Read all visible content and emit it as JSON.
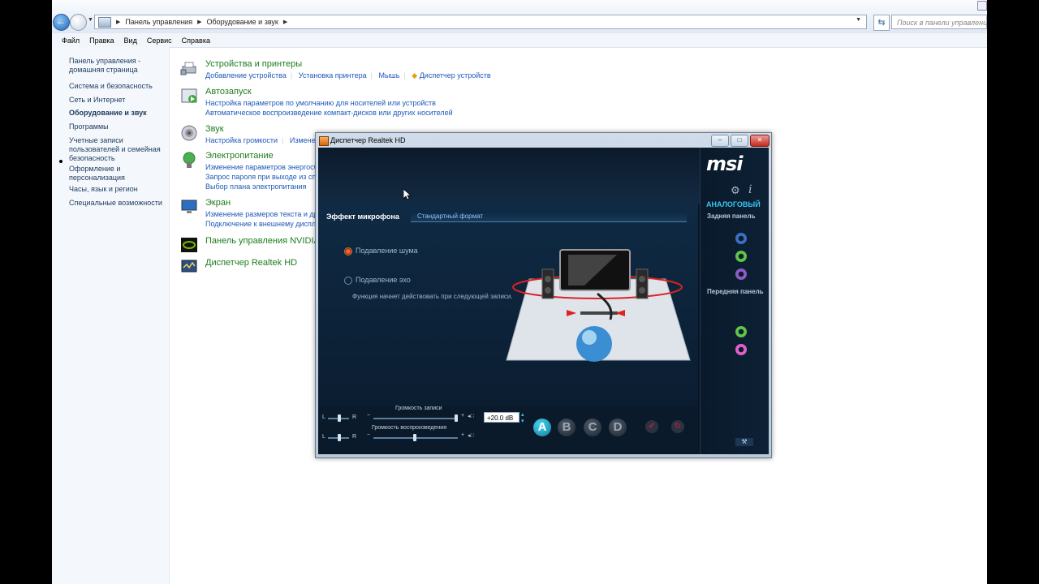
{
  "breadcrumb": {
    "root": "Панель управления",
    "current": "Оборудование и звук"
  },
  "search": {
    "placeholder": "Поиск в панели управления"
  },
  "menu": [
    "Файл",
    "Правка",
    "Вид",
    "Сервис",
    "Справка"
  ],
  "leftnav": [
    "Панель управления - домашняя страница",
    "Система и безопасность",
    "Сеть и Интернет",
    "Оборудование и звук",
    "Программы",
    "Учетные записи пользователей и семейная безопасность",
    "Оформление и персонализация",
    "Часы, язык и регион",
    "Специальные возможности"
  ],
  "categories": {
    "devices": {
      "title": "Устройства и принтеры",
      "links": [
        "Добавление устройства",
        "Установка принтера",
        "Мышь",
        "Диспетчер устройств"
      ]
    },
    "autoplay": {
      "title": "Автозапуск",
      "links": [
        "Настройка параметров по умолчанию для носителей или устройств",
        "Автоматическое воспроизведение компакт-дисков или других носителей"
      ]
    },
    "sound": {
      "title": "Звук",
      "links": [
        "Настройка громкости",
        "Измене"
      ]
    },
    "power": {
      "title": "Электропитание",
      "links": [
        "Изменение параметров энергосбе",
        "Запрос пароля при выходе из спя",
        "Выбор плана электропитания"
      ]
    },
    "display": {
      "title": "Экран",
      "links": [
        "Изменение размеров текста и других",
        "Подключение к внешнему дисплею"
      ]
    },
    "nvidia": {
      "title": "Панель управления NVIDIA"
    },
    "realtek": {
      "title": "Диспетчер Realtek HD"
    }
  },
  "realtek": {
    "title": "Диспетчер Realtek HD",
    "brand": "msi",
    "mode": "АНАЛОГОВЫЙ",
    "back_panel": "Задняя панель",
    "front_panel": "Передняя панель",
    "tab_active": "Эффект микрофона",
    "tab_inactive": "Стандартный формат",
    "noise_suppression": "Подавление шума",
    "echo_suppression": "Подавление эхо",
    "note": "Функция начнет действовать при следующей записи.",
    "rec_volume_label": "Громкость записи",
    "play_volume_label": "Громкость воспроизведения",
    "db_value": "+20.0 dB",
    "l": "L",
    "r": "R",
    "letters": [
      "A",
      "B",
      "C",
      "D"
    ],
    "colors": {
      "accent": "#37c6f1",
      "bg": "#0b1521"
    }
  }
}
